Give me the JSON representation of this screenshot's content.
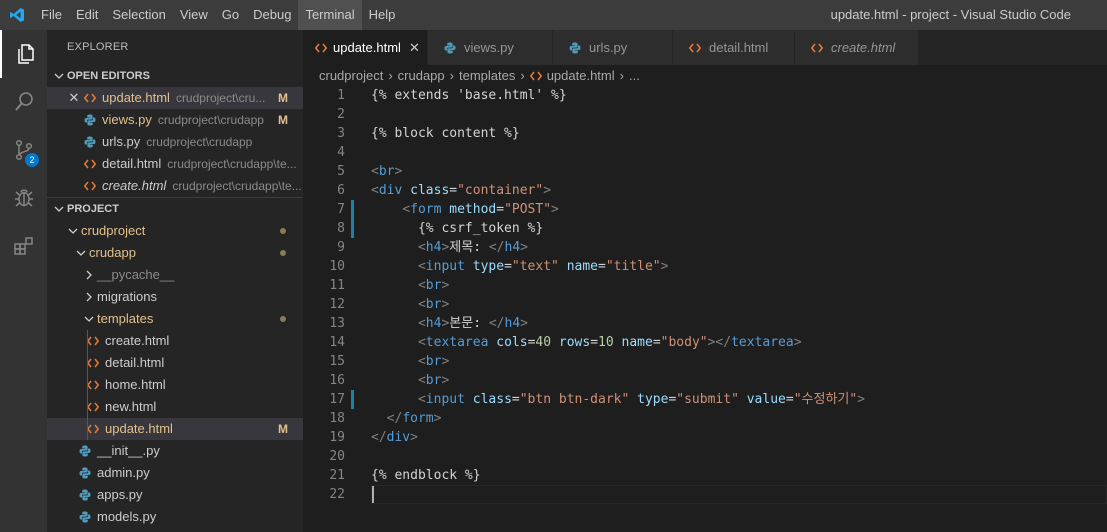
{
  "window_title": "update.html - project - Visual Studio Code",
  "menu": [
    "File",
    "Edit",
    "Selection",
    "View",
    "Go",
    "Debug",
    "Terminal",
    "Help"
  ],
  "activity_bar": {
    "scm_badge": "2"
  },
  "sidebar": {
    "title": "EXPLORER",
    "open_editors_label": "OPEN EDITORS",
    "open_editors": [
      {
        "name": "update.html",
        "path": "crudproject\\cru...",
        "mark": "M",
        "type": "html"
      },
      {
        "name": "views.py",
        "path": "crudproject\\crudapp",
        "mark": "M",
        "type": "py"
      },
      {
        "name": "urls.py",
        "path": "crudproject\\crudapp",
        "mark": "",
        "type": "py"
      },
      {
        "name": "detail.html",
        "path": "crudproject\\crudapp\\te...",
        "mark": "",
        "type": "html"
      },
      {
        "name": "create.html",
        "path": "crudproject\\crudapp\\te...",
        "mark": "",
        "type": "html"
      }
    ],
    "project_label": "PROJECT",
    "tree": [
      {
        "name": "crudproject"
      },
      {
        "name": "crudapp"
      },
      {
        "name": "__pycache__"
      },
      {
        "name": "migrations"
      },
      {
        "name": "templates"
      },
      {
        "name": "create.html"
      },
      {
        "name": "detail.html"
      },
      {
        "name": "home.html"
      },
      {
        "name": "new.html"
      },
      {
        "name": "update.html",
        "mark": "M"
      },
      {
        "name": "__init__.py"
      },
      {
        "name": "admin.py"
      },
      {
        "name": "apps.py"
      },
      {
        "name": "models.py"
      }
    ]
  },
  "tabs": [
    {
      "label": "update.html",
      "type": "html"
    },
    {
      "label": "views.py",
      "type": "py"
    },
    {
      "label": "urls.py",
      "type": "py"
    },
    {
      "label": "detail.html",
      "type": "html"
    },
    {
      "label": "create.html",
      "type": "html"
    }
  ],
  "breadcrumb": [
    "crudproject",
    "crudapp",
    "templates",
    "update.html",
    "..."
  ],
  "editor": {
    "line_numbers": [
      "1",
      "2",
      "3",
      "4",
      "5",
      "6",
      "7",
      "8",
      "9",
      "10",
      "11",
      "12",
      "13",
      "14",
      "15",
      "16",
      "17",
      "18",
      "19",
      "20",
      "21",
      "22"
    ],
    "text": {
      "l1": "{% extends 'base.html' %}",
      "l3": "{% block content %}",
      "br": "br",
      "div": "div",
      "class": "class",
      "container": "\"container\"",
      "form": "form",
      "method": "method",
      "post": "\"POST\"",
      "csrf": "{% csrf_token %}",
      "h4": "h4",
      "title_label": "제목: ",
      "input": "input",
      "type": "type",
      "text_val": "\"text\"",
      "name": "name",
      "title_val": "\"title\"",
      "body_label": "본문: ",
      "textarea": "textarea",
      "cols": "cols",
      "cols_val": "40",
      "rows": "rows",
      "rows_val": "10",
      "body_val": "\"body\"",
      "btn_class": "\"btn btn-dark\"",
      "submit_val": "\"submit\"",
      "value": "value",
      "submit_text": "\"수정하기\"",
      "l21": "{% endblock %}"
    }
  },
  "colors": {
    "accent": "#007acc",
    "modified": "#e2c08d",
    "html_icon": "#e37933",
    "py_icon": "#519aba"
  }
}
